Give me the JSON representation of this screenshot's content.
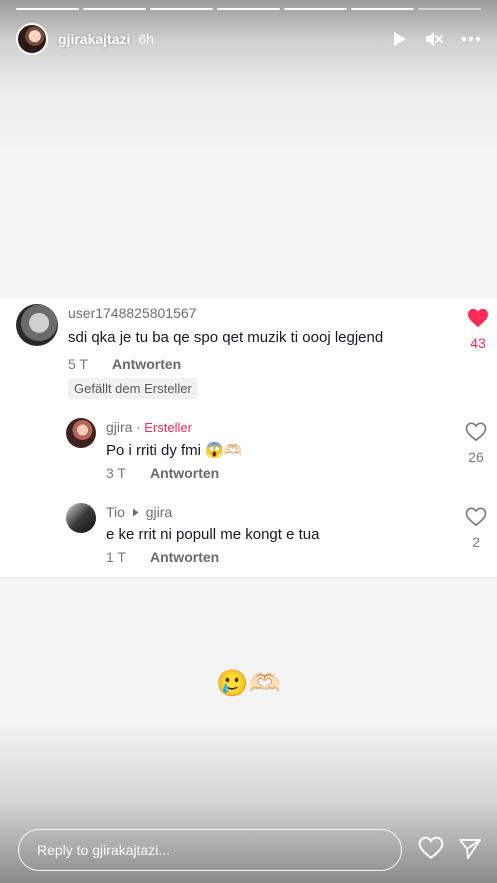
{
  "header": {
    "username": "gjirakajtazi",
    "time": "6h",
    "progress_segments": 7,
    "icons": [
      "play-icon",
      "mute-icon",
      "more-icon"
    ]
  },
  "comments": [
    {
      "username": "user1748825801567",
      "text": "sdi qka je tu ba qe spo qet muzik ti oooj legjend",
      "age": "5 T",
      "reply_label": "Antworten",
      "creator_tag": "Gefällt dem Ersteller",
      "likes": "43",
      "liked": true
    },
    {
      "username": "gjira",
      "badge": "· Ersteller",
      "text": "Po i rriti dy fmi 😱🫶🏻",
      "age": "3 T",
      "reply_label": "Antworten",
      "likes": "26",
      "liked": false
    },
    {
      "username": "Tio",
      "reply_to": "gjira",
      "text": "e ke rrit ni popull me kongt e tua",
      "age": "1 T",
      "reply_label": "Antworten",
      "likes": "2",
      "liked": false
    }
  ],
  "story_caption": "🥲🫶🏻",
  "footer": {
    "reply_placeholder": "Reply to gjirakajtazi...",
    "icons": [
      "heart-icon",
      "send-icon"
    ]
  },
  "colors": {
    "accent": "#fe2c55",
    "text": "#161823",
    "muted": "#7a7a7a"
  }
}
